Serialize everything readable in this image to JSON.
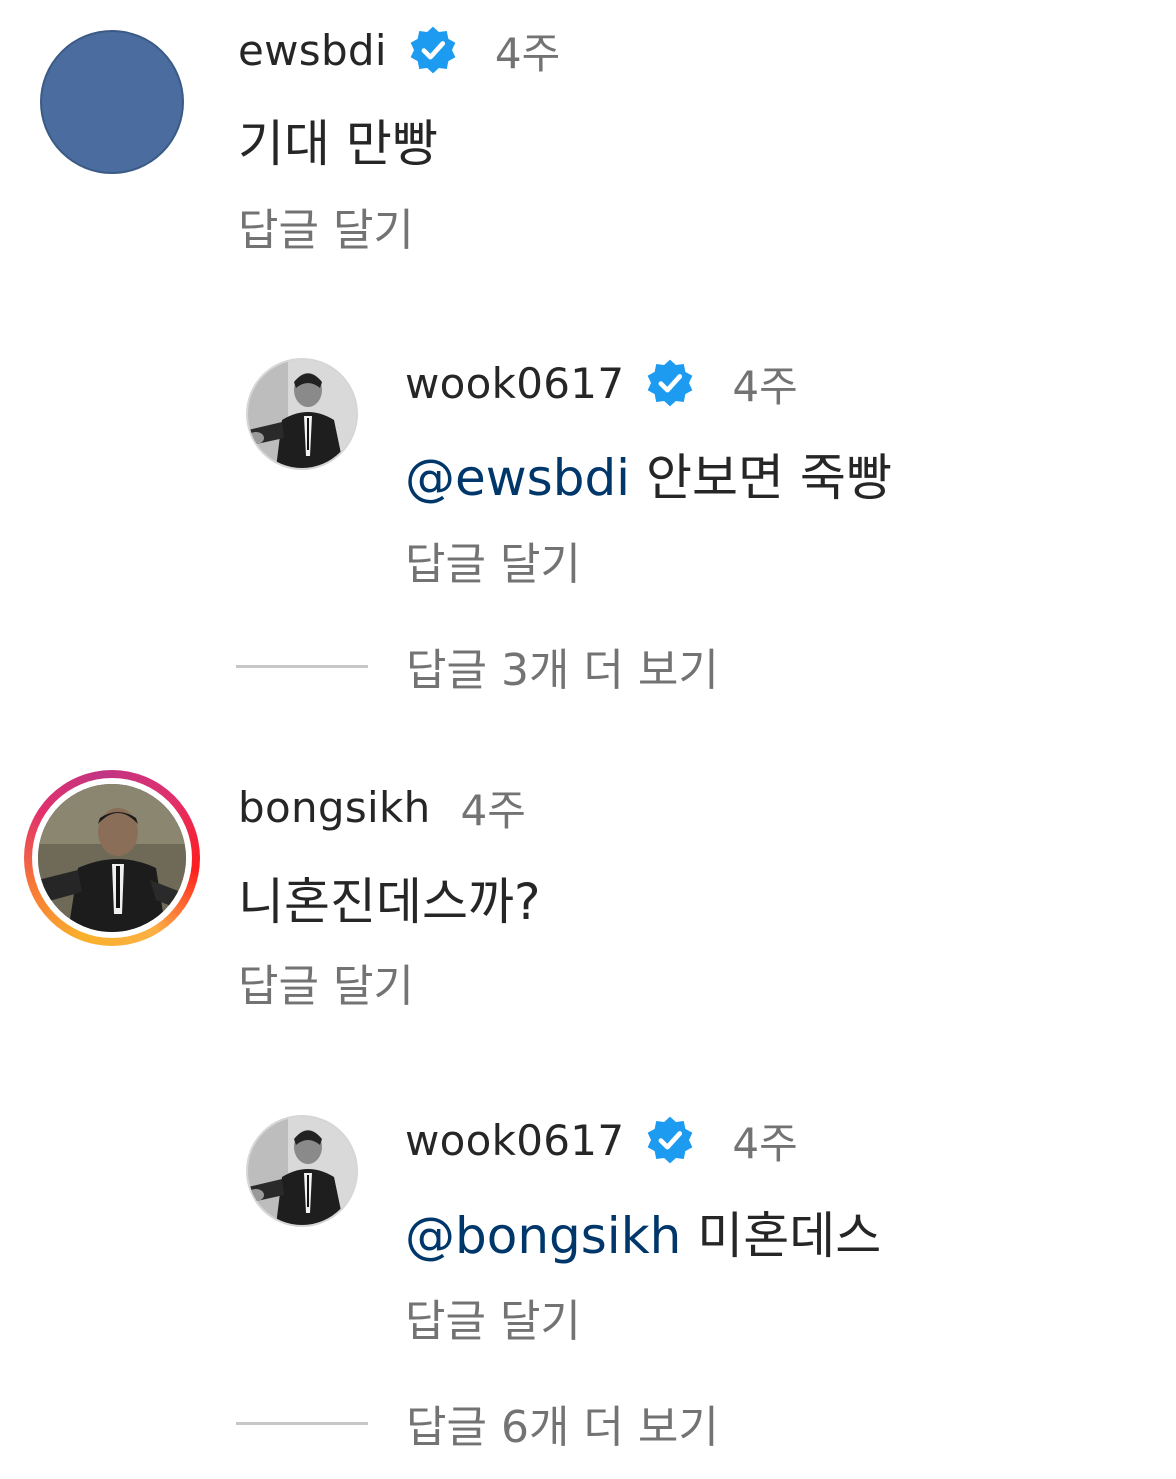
{
  "colors": {
    "verified_badge": "#1d9bf0",
    "mention": "#00376b",
    "secondary_text": "#737373",
    "primary_text": "#262626"
  },
  "comments": [
    {
      "username": "ewsbdi",
      "verified": true,
      "time": "4주",
      "text": "기대 만빵",
      "reply_label": "답글 달기",
      "avatar": "plain-blue-avatar",
      "replies": [
        {
          "username": "wook0617",
          "verified": true,
          "time": "4주",
          "mention": "@ewsbdi",
          "text": " 안보면 죽빵",
          "reply_label": "답글 달기",
          "avatar": "man-in-suit-photo"
        }
      ],
      "more_replies": "답글 3개 더 보기"
    },
    {
      "username": "bongsikh",
      "verified": false,
      "time": "4주",
      "text": "니혼진데스까?",
      "reply_label": "답글 달기",
      "avatar": "man-in-suit-photo-story-ring",
      "replies": [
        {
          "username": "wook0617",
          "verified": true,
          "time": "4주",
          "mention": "@bongsikh",
          "text": " 미혼데스",
          "reply_label": "답글 달기",
          "avatar": "man-in-suit-photo"
        }
      ],
      "more_replies": "답글 6개 더 보기"
    }
  ]
}
